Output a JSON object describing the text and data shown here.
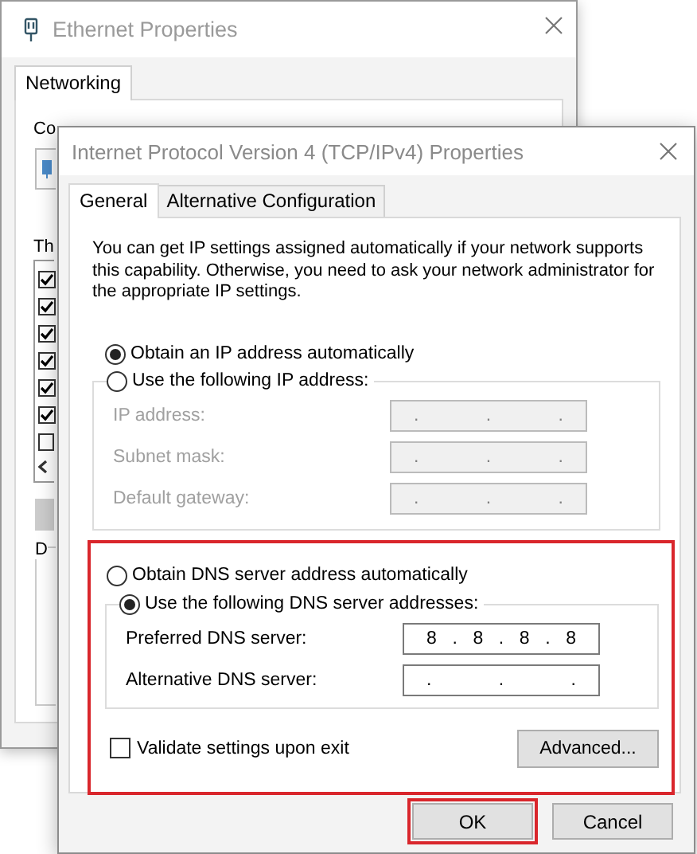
{
  "back_window": {
    "title": "Ethernet Properties",
    "tabs": [
      {
        "label": "Networking",
        "selected": true
      }
    ],
    "partial_label_1": "Co",
    "partial_label_2": "Th",
    "list_items": [
      {
        "checked": true
      },
      {
        "checked": true
      },
      {
        "checked": true
      },
      {
        "checked": true
      },
      {
        "checked": true
      },
      {
        "checked": true
      },
      {
        "checked": false
      }
    ],
    "group_label": "D"
  },
  "dialog": {
    "title": "Internet Protocol Version 4 (TCP/IPv4) Properties",
    "tabs": [
      {
        "label": "General",
        "selected": true
      },
      {
        "label": "Alternative Configuration",
        "selected": false
      }
    ],
    "description": "You can get IP settings assigned automatically if your network supports this capability. Otherwise, you need to ask your network administrator for the appropriate IP settings.",
    "ip_options": [
      {
        "label": "Obtain an IP address automatically",
        "selected": true
      },
      {
        "label": "Use the following IP address:",
        "selected": false
      }
    ],
    "ip_fields": [
      {
        "label": "IP address:",
        "value": ". . .",
        "disabled": true
      },
      {
        "label": "Subnet mask:",
        "value": ". . .",
        "disabled": true
      },
      {
        "label": "Default gateway:",
        "value": ". . .",
        "disabled": true
      }
    ],
    "dns_section": {
      "highlighted": true,
      "options": [
        {
          "label": "Obtain DNS server address automatically",
          "selected": false
        },
        {
          "label": "Use the following DNS server addresses:",
          "selected": true
        }
      ],
      "fields": [
        {
          "label": "Preferred DNS server:",
          "value": "8 . 8 . 8 . 8",
          "disabled": false
        },
        {
          "label": "Alternative DNS server:",
          "value": ". . .",
          "disabled": false
        }
      ],
      "validate": {
        "label": "Validate settings upon exit",
        "checked": false
      },
      "advanced_button": "Advanced..."
    },
    "buttons": [
      {
        "label": "OK",
        "highlighted": true
      },
      {
        "label": "Cancel",
        "highlighted": false
      }
    ]
  }
}
